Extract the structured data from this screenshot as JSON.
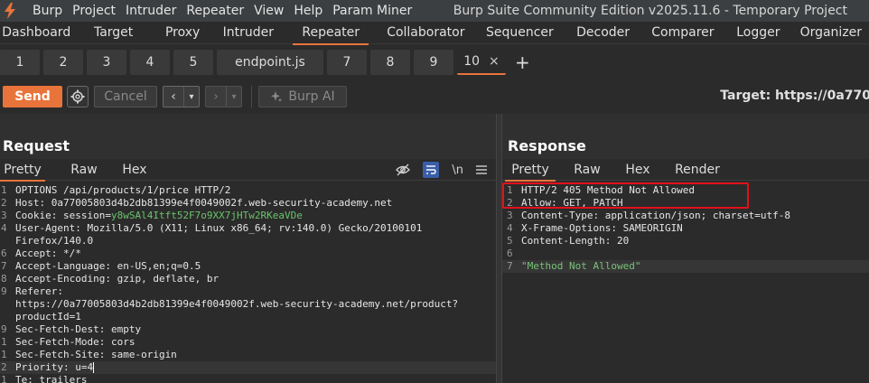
{
  "menu": {
    "items": [
      "Burp",
      "Project",
      "Intruder",
      "Repeater",
      "View",
      "Help",
      "Param Miner"
    ],
    "window_title": "Burp Suite Community Edition v2025.11.6 - Temporary Project"
  },
  "main_tabs": [
    "Dashboard",
    "Target",
    "Proxy",
    "Intruder",
    "Repeater",
    "Collaborator",
    "Sequencer",
    "Decoder",
    "Comparer",
    "Logger",
    "Organizer"
  ],
  "main_tab_active": "Repeater",
  "repeater_tabs": [
    "1",
    "2",
    "3",
    "4",
    "5",
    "endpoint.js",
    "7",
    "8",
    "9",
    "10"
  ],
  "repeater_tab_active": "10",
  "repeater_tab_close": "×",
  "repeater_add": "+",
  "toolbar": {
    "send_label": "Send",
    "cancel_label": "Cancel",
    "back_label": "‹",
    "forward_label": "›",
    "dropdown_label": "▾",
    "burp_ai_label": "Burp AI",
    "target_label": "Target: https://0a770"
  },
  "request": {
    "title": "Request",
    "tabs": [
      "Pretty",
      "Raw",
      "Hex"
    ],
    "active_tab": "Pretty",
    "newline_tool": "\\n",
    "lines": [
      {
        "n": "1",
        "text": "OPTIONS /api/products/1/price HTTP/2"
      },
      {
        "n": "2",
        "text": "Host: 0a77005803d4b2db81399e4f0049002f.web-security-academy.net"
      },
      {
        "n": "3",
        "prefix": "Cookie: session=",
        "value": "y8wSAl4Itft52F7o9XX7jHTw2RKeaVDe"
      },
      {
        "n": "4",
        "text": "User-Agent: Mozilla/5.0 (X11; Linux x86_64; rv:140.0) Gecko/20100101"
      },
      {
        "n": "",
        "text": "Firefox/140.0"
      },
      {
        "n": "6",
        "text": "Accept: */*"
      },
      {
        "n": "7",
        "text": "Accept-Language: en-US,en;q=0.5"
      },
      {
        "n": "8",
        "text": "Accept-Encoding: gzip, deflate, br"
      },
      {
        "n": "9",
        "text": "Referer:"
      },
      {
        "n": "",
        "text": "https://0a77005803d4b2db81399e4f0049002f.web-security-academy.net/product?"
      },
      {
        "n": "",
        "text": "productId=1"
      },
      {
        "n": "9",
        "text": "Sec-Fetch-Dest: empty"
      },
      {
        "n": "1",
        "text": "Sec-Fetch-Mode: cors"
      },
      {
        "n": "1",
        "text": "Sec-Fetch-Site: same-origin"
      },
      {
        "n": "2",
        "text": "Priority: u=4"
      },
      {
        "n": "1",
        "text": "Te: trailers"
      }
    ]
  },
  "response": {
    "title": "Response",
    "tabs": [
      "Pretty",
      "Raw",
      "Hex",
      "Render"
    ],
    "active_tab": "Pretty",
    "lines": [
      {
        "n": "1",
        "text": "HTTP/2 405 Method Not Allowed"
      },
      {
        "n": "2",
        "text": "Allow: GET, PATCH"
      },
      {
        "n": "3",
        "text": "Content-Type: application/json; charset=utf-8"
      },
      {
        "n": "4",
        "text": "X-Frame-Options: SAMEORIGIN"
      },
      {
        "n": "5",
        "text": "Content-Length: 20"
      },
      {
        "n": "6",
        "text": ""
      },
      {
        "n": "7",
        "text": "\"Method Not Allowed\""
      }
    ]
  },
  "colors": {
    "accent": "#e8743b",
    "annotation_box": "#e3101a",
    "cookie_value": "#6ac46a",
    "json_string": "#79c279"
  }
}
